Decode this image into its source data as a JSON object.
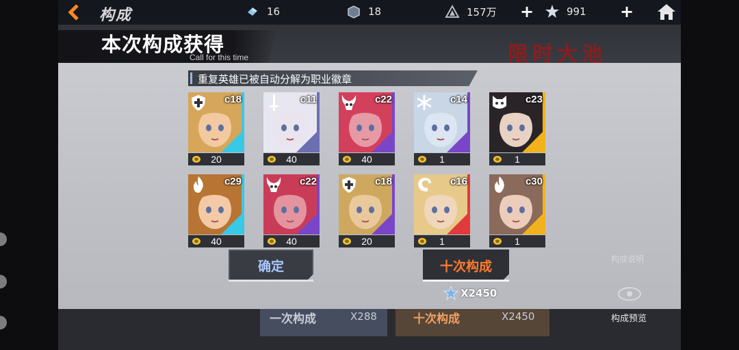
{
  "topbar": {
    "title": "构成",
    "resources": [
      {
        "icon": "crystal-icon",
        "value": "16"
      },
      {
        "icon": "cube-icon",
        "value": "18"
      },
      {
        "icon": "triangle-coin-icon",
        "value": "157万"
      },
      {
        "icon": "star-gem-icon",
        "value": "991"
      }
    ]
  },
  "panel": {
    "title": "本次构成获得",
    "subtitle": "Call for this time",
    "notice": "重复英雄已被自动分解为职业徽章"
  },
  "cards": [
    {
      "code": "c18",
      "badge": "20",
      "role_icon": "shield-cross-icon",
      "color": "#38c9e6"
    },
    {
      "code": "c11",
      "badge": "40",
      "role_icon": "sword-icon",
      "color": "#6b6fb2"
    },
    {
      "code": "c22",
      "badge": "40",
      "role_icon": "horned-mask-icon",
      "color": "#7a46c8"
    },
    {
      "code": "c14",
      "badge": "1",
      "role_icon": "snowflake-icon",
      "color": "#7a46c8"
    },
    {
      "code": "c23",
      "badge": "1",
      "role_icon": "cat-mask-icon",
      "color": "#f2b21d"
    },
    {
      "code": "c29",
      "badge": "40",
      "role_icon": "flame-icon",
      "color": "#38c9e6"
    },
    {
      "code": "c22",
      "badge": "40",
      "role_icon": "horned-mask-icon",
      "color": "#7a46c8"
    },
    {
      "code": "c18",
      "badge": "20",
      "role_icon": "shield-cross-icon",
      "color": "#7a46c8"
    },
    {
      "code": "c16",
      "badge": "1",
      "role_icon": "dragon-icon",
      "color": "#e23a3a"
    },
    {
      "code": "c30",
      "badge": "1",
      "role_icon": "flame-icon",
      "color": "#f2b21d"
    }
  ],
  "buttons": {
    "confirm": "确定",
    "ten_pull": "十次构成",
    "ten_cost": "X2450"
  },
  "background": {
    "limited": "限时",
    "one_pull": "一次构成",
    "one_cost": "X288",
    "ten_pull": "十次构成",
    "ten_cost": "X2450",
    "preview": "构成预览",
    "desc": "构成说明"
  }
}
